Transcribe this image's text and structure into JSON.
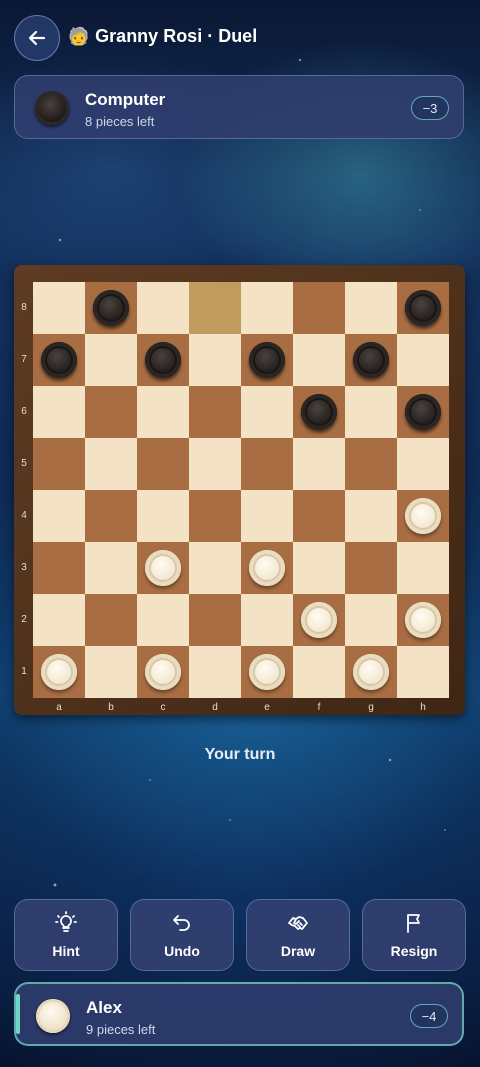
{
  "header": {
    "title": "Granny Rosi · Duel",
    "avatar": "🧓"
  },
  "opponent": {
    "name": "Computer",
    "pieces_left": "8 pieces left",
    "score_badge": "−3",
    "piece_color": "black"
  },
  "player": {
    "name": "Alex",
    "pieces_left": "9 pieces left",
    "score_badge": "−4",
    "piece_color": "white"
  },
  "board": {
    "files": [
      "a",
      "b",
      "c",
      "d",
      "e",
      "f",
      "g",
      "h"
    ],
    "ranks": [
      "8",
      "7",
      "6",
      "5",
      "4",
      "3",
      "2",
      "1"
    ],
    "highlighted_square": "d8",
    "pieces": {
      "black": [
        "b8",
        "h8",
        "a7",
        "c7",
        "e7",
        "g7",
        "f6",
        "h6"
      ],
      "white": [
        "h4",
        "c3",
        "e3",
        "f2",
        "h2",
        "a1",
        "c1",
        "e1",
        "g1"
      ]
    }
  },
  "status": {
    "turn_text": "Your turn"
  },
  "actions": [
    {
      "label": "Hint",
      "icon": "lightbulb-icon"
    },
    {
      "label": "Undo",
      "icon": "undo-icon"
    },
    {
      "label": "Draw",
      "icon": "handshake-icon"
    },
    {
      "label": "Resign",
      "icon": "flag-icon"
    }
  ],
  "colors": {
    "light_square": "#f3e2c4",
    "dark_square": "#a86d42",
    "highlight_square": "#c19a5e",
    "accent": "#6fd6c6"
  }
}
